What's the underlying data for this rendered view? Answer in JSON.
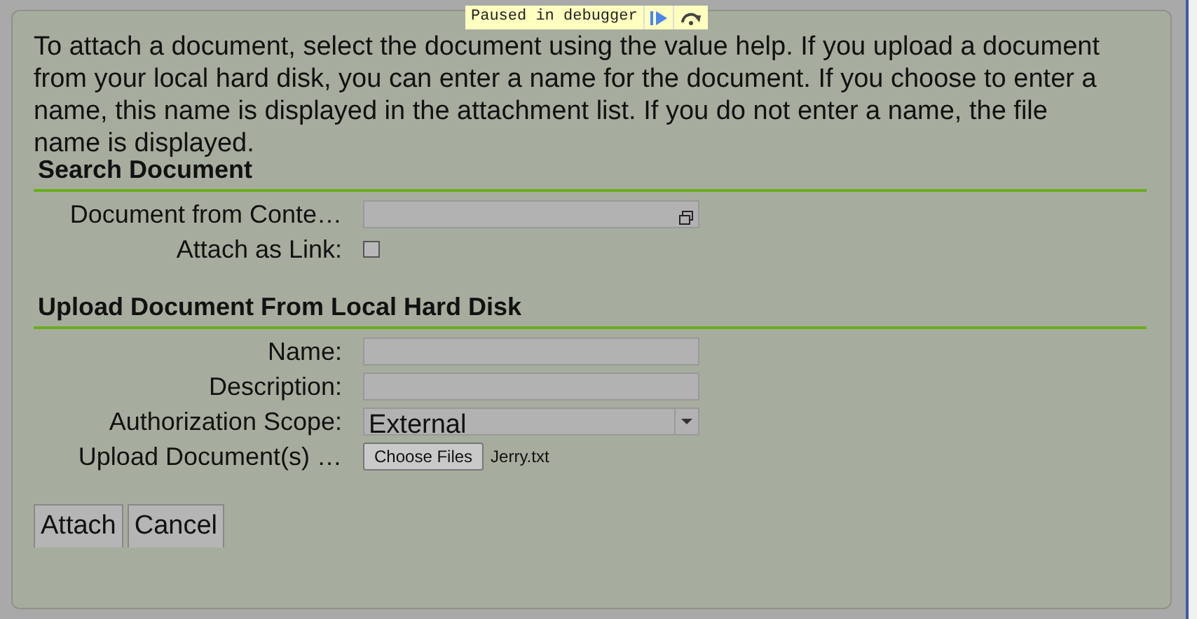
{
  "debugger": {
    "label": "Paused in debugger"
  },
  "intro": "To attach a document, select the document using the value help. If you upload a document from your local hard disk, you can enter a name for the document. If you choose to enter a name, this name is displayed in the attachment list. If you do not enter a name, the file name is displayed.",
  "sections": [
    {
      "title": "Search Document",
      "fields": [
        {
          "kind": "lookup",
          "label": "Document from Conte…"
        },
        {
          "kind": "checkbox",
          "label": "Attach as Link:",
          "checked": false
        }
      ]
    },
    {
      "title": "Upload Document From Local Hard Disk",
      "fields": [
        {
          "kind": "text",
          "label": "Name:"
        },
        {
          "kind": "text",
          "label": "Description:"
        },
        {
          "kind": "select",
          "label": "Authorization Scope:",
          "value": "External"
        },
        {
          "kind": "file",
          "label": "Upload Document(s) …",
          "button": "Choose Files",
          "file_name": "Jerry.txt"
        }
      ]
    }
  ],
  "buttons": [
    "Attach",
    "Cancel"
  ]
}
